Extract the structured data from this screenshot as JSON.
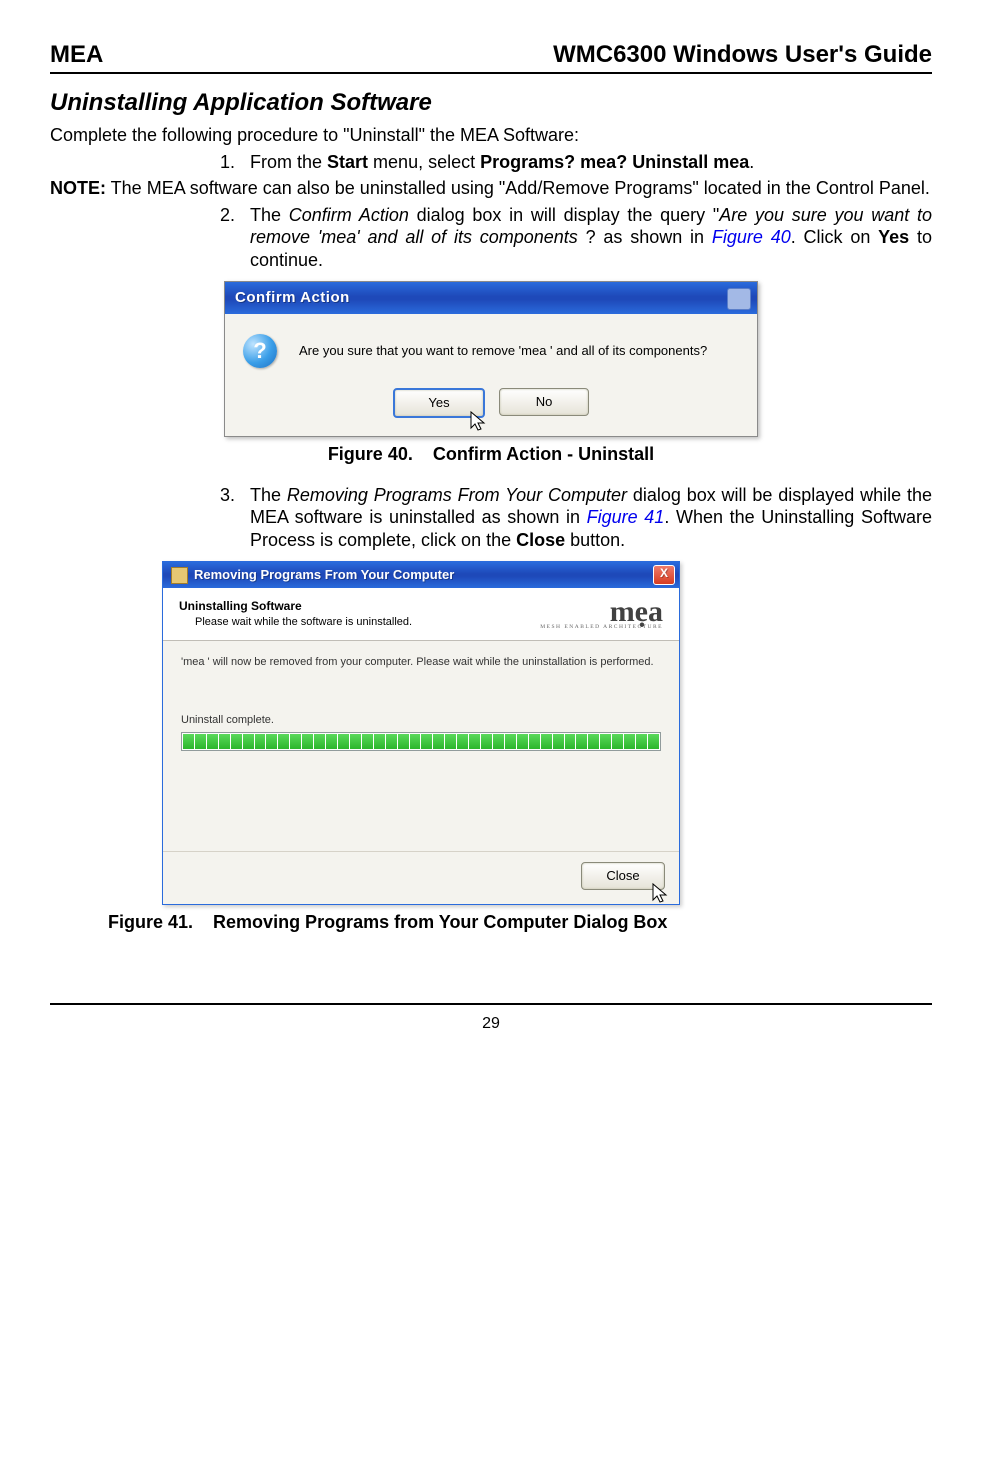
{
  "header": {
    "left": "MEA",
    "right": "WMC6300 Windows User's Guide"
  },
  "section_heading": "Uninstalling Application Software",
  "intro": "Complete the following procedure to \"Uninstall\" the MEA Software:",
  "step1": {
    "num": "1.",
    "pre": "From the ",
    "start": "Start",
    "mid1": " menu, select ",
    "programs": "Programs",
    "q1": "? ",
    "mea": "mea",
    "q2": "? ",
    "uninstall": "Uninstall mea",
    "dot": "."
  },
  "note": {
    "label": "NOTE:",
    "text": "  The MEA software can also be uninstalled using \"Add/Remove Programs\" located in the Control Panel."
  },
  "step2": {
    "num": "2.",
    "t1": "The ",
    "i1": "Confirm Action",
    "t2": " dialog box in will display the query \"",
    "i2": "Are you sure you want to remove 'mea' and all of its components",
    "t3": " ? as shown in ",
    "link": "Figure 40",
    "t4": ". Click on ",
    "yes": "Yes",
    "t5": " to continue."
  },
  "dialog1": {
    "title": "Confirm Action",
    "question_mark": "?",
    "msg": "Are you sure that you want to remove 'mea ' and all of its components?",
    "yes": "Yes",
    "no": "No"
  },
  "figcap1": {
    "label": "Figure 40.",
    "text": "Confirm Action - Uninstall"
  },
  "step3": {
    "num": "3.",
    "t1": "The ",
    "i1": "Removing Programs From Your Computer",
    "t2": " dialog box will be displayed while the MEA software is uninstalled as shown in ",
    "link": "Figure 41",
    "t3": ". When the Uninstalling Software Process is complete, click on the ",
    "close": "Close",
    "t4": " button."
  },
  "dialog2": {
    "title": "Removing Programs From Your Computer",
    "close_x": "X",
    "hdr_title": "Uninstalling Software",
    "hdr_sub": "Please wait while the software is uninstalled.",
    "logo_big": "mẹa",
    "logo_sub": "MESH ENABLED ARCHITECTURE",
    "body_msg": "'mea ' will now be removed from your computer. Please wait while the uninstallation is performed.",
    "status": "Uninstall complete.",
    "close_btn": "Close"
  },
  "figcap2": {
    "label": "Figure 41.",
    "text": "Removing Programs from Your Computer Dialog Box"
  },
  "page_number": "29"
}
